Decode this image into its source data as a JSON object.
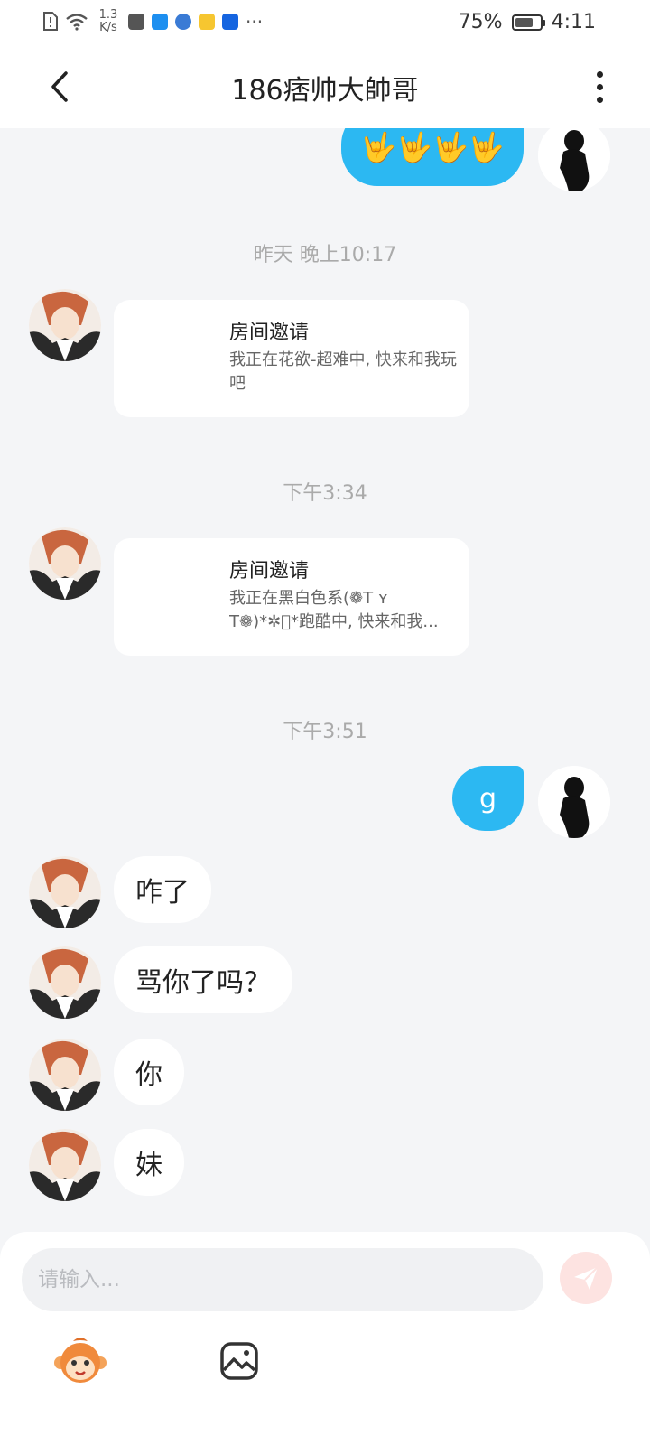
{
  "status_bar": {
    "net_speed": "1.3 K/s",
    "battery": "75%",
    "battery_level": 0.75,
    "time": "4:11"
  },
  "header": {
    "title": "186痞帅大帥哥"
  },
  "messages": {
    "top_outgoing": "🤟🤟🤟🤟",
    "ts1": "昨天 晚上10:17",
    "invite1": {
      "title": "房间邀请",
      "desc": "我正在花欲-超难中, 快来和我玩吧"
    },
    "ts2": "下午3:34",
    "invite2": {
      "title": "房间邀请",
      "desc": "我正在黑白色系(❁T ʏ T❁)*✲゚*跑酷中, 快来和我..."
    },
    "ts3": "下午3:51",
    "out_g": "g",
    "in1": "咋了",
    "in2": "骂你了吗？",
    "in3": "你",
    "in4": "妹"
  },
  "input": {
    "placeholder": "请输入..."
  },
  "colors": {
    "outgoing_bubble": "#2cb8f2",
    "background": "#f4f5f7",
    "send_disabled": "#fde3e1"
  }
}
